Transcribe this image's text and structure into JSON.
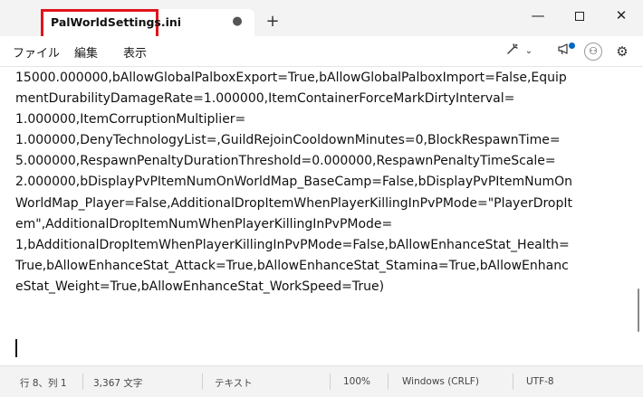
{
  "tab": {
    "title": "PalWorldSettings.ini",
    "unsaved_dot": "●",
    "new_tab": "+"
  },
  "window": {
    "minimize": "—",
    "close": "✕"
  },
  "menu": {
    "file": "ファイル",
    "edit": "編集",
    "view": "表示"
  },
  "toolbar": {
    "copilot_icon": "copilot-icon",
    "chevron": "⌄",
    "avatar": "⚇",
    "gear": "⚙"
  },
  "editor": {
    "lines": [
      "15000.000000,bAllowGlobalPalboxExport=True,bAllowGlobalPalboxImport=False,Equip",
      "mentDurabilityDamageRate=1.000000,ItemContainerForceMarkDirtyInterval=",
      "1.000000,ItemCorruptionMultiplier=",
      "1.000000,DenyTechnologyList=,GuildRejoinCooldownMinutes=0,BlockRespawnTime=",
      "5.000000,RespawnPenaltyDurationThreshold=0.000000,RespawnPenaltyTimeScale=",
      "2.000000,bDisplayPvPItemNumOnWorldMap_BaseCamp=False,bDisplayPvPItemNumOn",
      "WorldMap_Player=False,AdditionalDropItemWhenPlayerKillingInPvPMode=\"PlayerDropIt",
      "em\",AdditionalDropItemNumWhenPlayerKillingInPvPMode=",
      "1,bAdditionalDropItemWhenPlayerKillingInPvPMode=False,bAllowEnhanceStat_Health=",
      "True,bAllowEnhanceStat_Attack=True,bAllowEnhanceStat_Stamina=True,bAllowEnhanc",
      "eStat_Weight=True,bAllowEnhanceStat_WorkSpeed=True)"
    ]
  },
  "status": {
    "position": "行 8、列 1",
    "chars": "3,367 文字",
    "format": "テキスト",
    "zoom": "100%",
    "line_ending": "Windows (CRLF)",
    "encoding": "UTF-8"
  },
  "colors": {
    "highlight": "#e0141b",
    "accent": "#0067c0"
  }
}
